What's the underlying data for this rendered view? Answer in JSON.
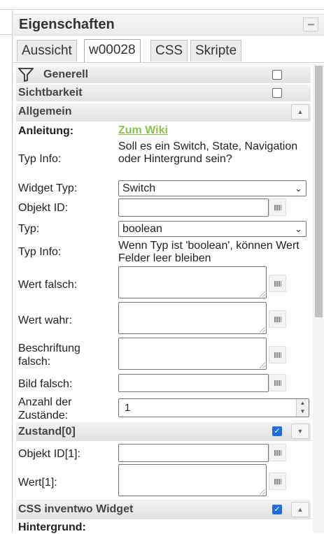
{
  "panel": {
    "title": "Eigenschaften",
    "tabs": [
      "Aussicht",
      "w00028",
      "CSS",
      "Skripte"
    ],
    "active_tab": "w00028"
  },
  "sections": {
    "generell": "Generell",
    "sichtbarkeit": "Sichtbarkeit",
    "allgemein": "Allgemein",
    "zustand": "Zustand[0]",
    "css_widget": "CSS inventwo Widget"
  },
  "fields": {
    "anleitung_label": "Anleitung:",
    "anleitung_link": "Zum Wiki",
    "typinfo1_label": "Typ Info:",
    "typinfo1_text": "Soll es ein Switch, State, Navigation oder Hintergrund sein?",
    "widget_typ_label": "Widget Typ:",
    "widget_typ_value": "Switch",
    "objekt_id_label": "Objekt ID:",
    "objekt_id_value": "",
    "typ_label": "Typ:",
    "typ_value": "boolean",
    "typinfo2_label": "Typ Info:",
    "typinfo2_text": "Wenn Typ ist 'boolean', können Wert Felder leer bleiben",
    "wert_falsch_label": "Wert falsch:",
    "wert_wahr_label": "Wert wahr:",
    "beschriftung_falsch_label": "Beschriftung falsch:",
    "bild_falsch_label": "Bild falsch:",
    "anzahl_label": "Anzahl der Zustände:",
    "anzahl_value": "1",
    "objekt_id1_label": "Objekt ID[1]:",
    "wert1_label": "Wert[1]:",
    "hintergrund_label": "Hintergrund:"
  },
  "checks": {
    "generell": false,
    "sichtbarkeit": false,
    "zustand": true,
    "css_widget": true
  },
  "icons": {
    "filter": "filter-icon",
    "minimize": "minimize-icon",
    "collapse": "chevron-up-icon",
    "expand": "chevron-down-icon",
    "select": "select-dialog-icon",
    "checkbox_accent": "#1e6fd9",
    "link_color": "#8bc34a"
  }
}
